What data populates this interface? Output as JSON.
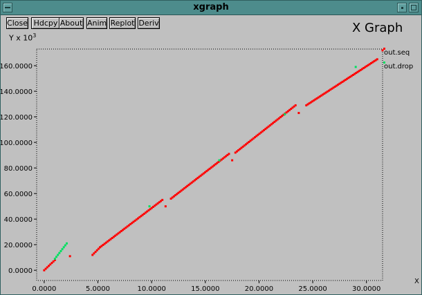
{
  "window": {
    "title": "xgraph",
    "titlebar_color": "#4d8c8c",
    "icons": [
      "window-menu-icon",
      "minimize-icon",
      "maximize-icon"
    ]
  },
  "toolbar": {
    "close_label": "Close",
    "hdcpy_label": "Hdcpy",
    "about_label": "About",
    "anim_label": "Anim",
    "replot_label": "Replot",
    "deriv_label": "Deriv"
  },
  "chart_data": {
    "type": "scatter",
    "title": "X Graph",
    "ylabel_prefix": "Y x 10",
    "ylabel_exponent": "3",
    "xlabel": "X",
    "x_ticks": [
      "0.0000",
      "5.0000",
      "10.0000",
      "15.0000",
      "20.0000",
      "25.0000",
      "30.0000"
    ],
    "x_tick_values": [
      0,
      5000,
      10000,
      15000,
      20000,
      25000,
      30000
    ],
    "y_ticks": [
      "0.0000",
      "20.0000",
      "40.0000",
      "60.0000",
      "80.0000",
      "100.0000",
      "120.0000",
      "140.0000",
      "160.0000"
    ],
    "y_tick_values": [
      0,
      20,
      40,
      60,
      80,
      100,
      120,
      140,
      160
    ],
    "xlim": [
      -700,
      31500
    ],
    "ylim": [
      -8,
      173
    ],
    "grid": "dotted frame",
    "legend_position": "right",
    "background": "#c0c0c0",
    "series": [
      {
        "name": "out.seq",
        "color": "#ff0000",
        "segments": [
          [
            [
              0,
              0
            ],
            [
              1000,
              8
            ]
          ],
          [
            [
              4500,
              12
            ],
            [
              5200,
              18
            ],
            [
              11000,
              55
            ]
          ],
          [
            [
              11800,
              56
            ],
            [
              17200,
              91
            ]
          ],
          [
            [
              17800,
              92
            ],
            [
              23400,
              129
            ]
          ],
          [
            [
              24400,
              129
            ],
            [
              31000,
              165
            ]
          ]
        ],
        "points": [
          [
            2400,
            11
          ],
          [
            11300,
            50
          ],
          [
            17500,
            86
          ],
          [
            23700,
            123
          ],
          [
            31500,
            172
          ]
        ]
      },
      {
        "name": "out.drop",
        "color": "#00e060",
        "segments": [
          [
            [
              1000,
              9
            ],
            [
              2100,
              21
            ]
          ]
        ],
        "points": [
          [
            9800,
            50
          ],
          [
            16300,
            86
          ],
          [
            22400,
            122
          ],
          [
            29000,
            159
          ]
        ]
      }
    ]
  }
}
